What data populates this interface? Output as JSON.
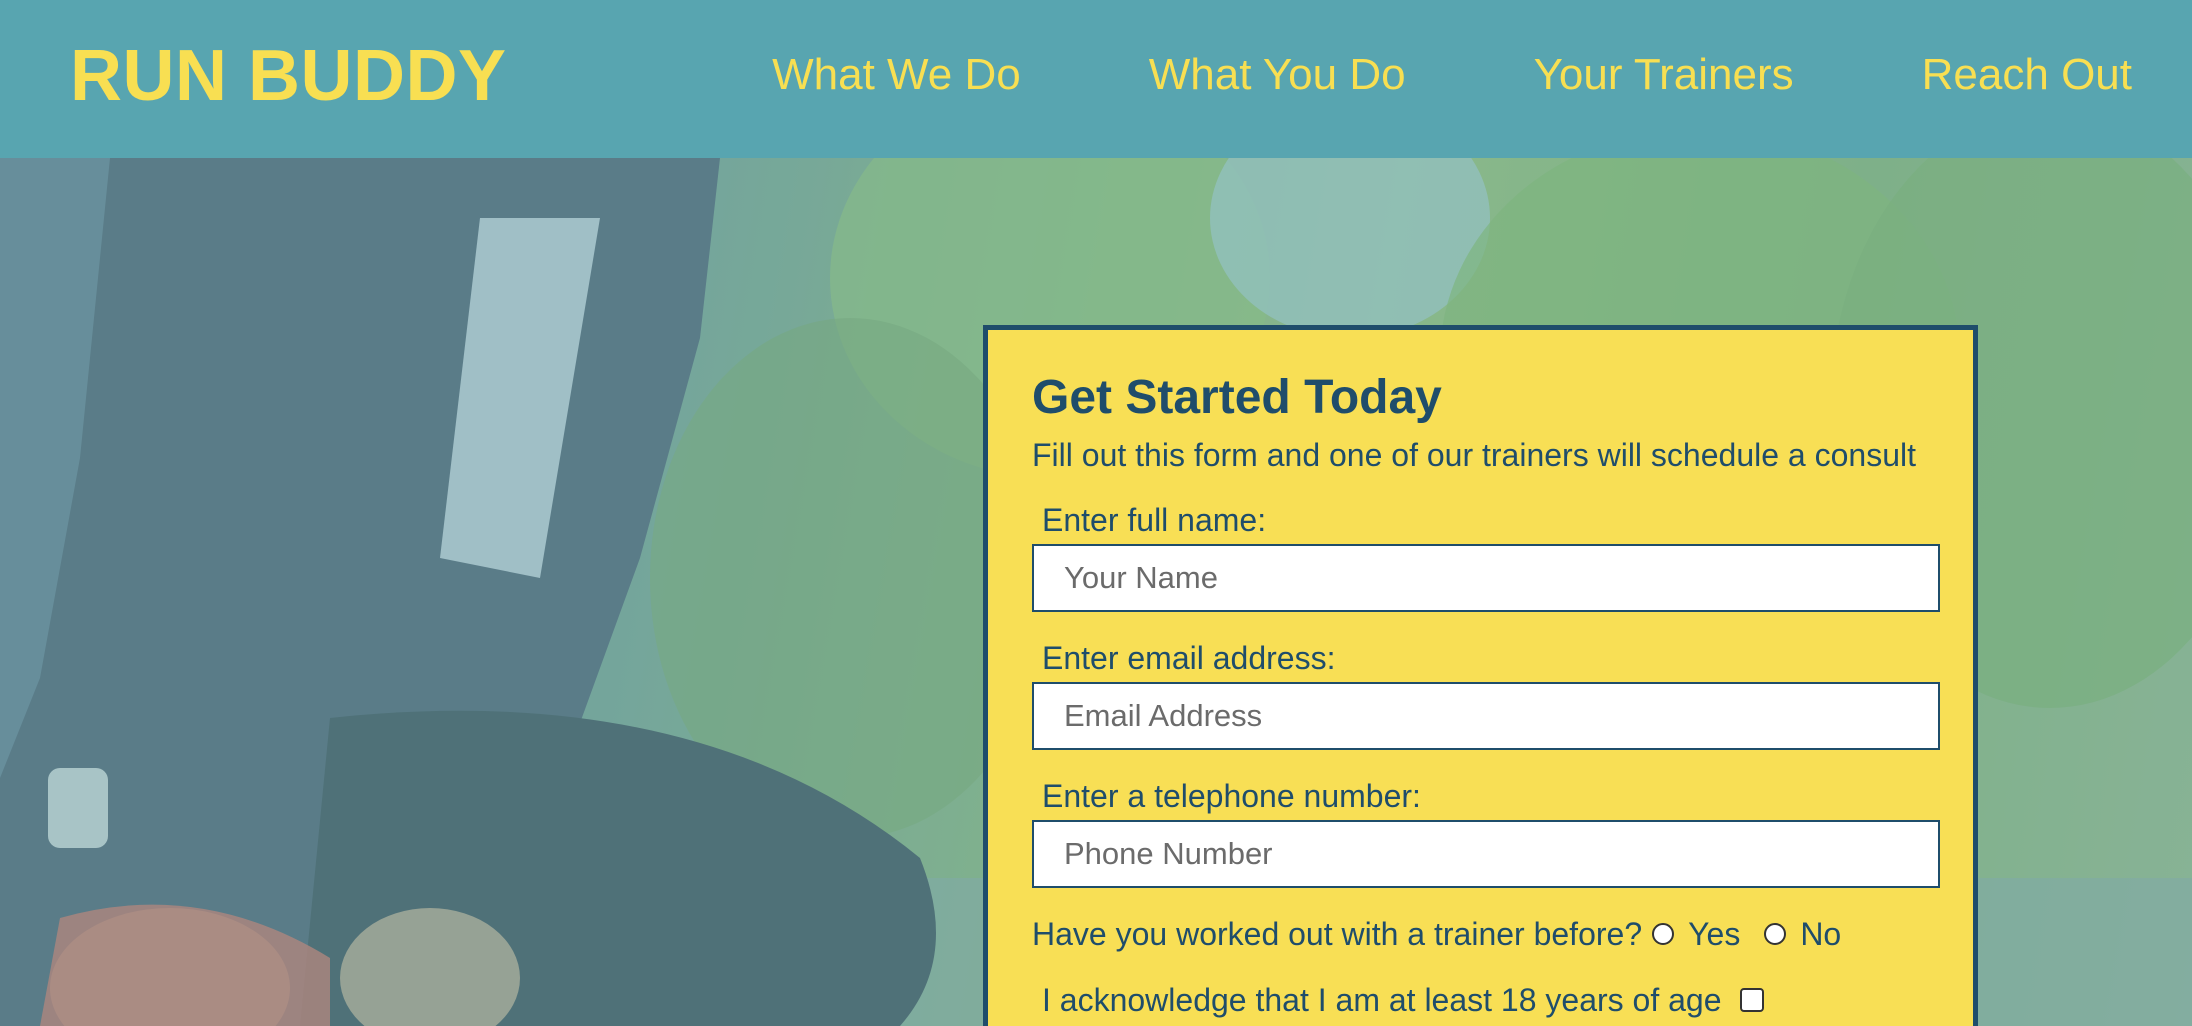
{
  "header": {
    "logo": "RUN BUDDY",
    "nav": [
      {
        "label": "What We Do"
      },
      {
        "label": "What You Do"
      },
      {
        "label": "Your Trainers"
      },
      {
        "label": "Reach Out"
      }
    ]
  },
  "form": {
    "title": "Get Started Today",
    "subtitle": "Fill out this form and one of our trainers will schedule a consult",
    "name_label": "Enter full name:",
    "name_placeholder": "Your Name",
    "email_label": "Enter email address:",
    "email_placeholder": "Email Address",
    "phone_label": "Enter a telephone number:",
    "phone_placeholder": "Phone Number",
    "trainer_question": "Have you worked out with a trainer before?",
    "option_yes": "Yes",
    "option_no": "No",
    "age_ack": "I acknowledge that I am at least 18 years of age"
  },
  "colors": {
    "header_bg": "#58a5b0",
    "accent_yellow": "#f8df52",
    "form_text": "#1f4d6b"
  }
}
